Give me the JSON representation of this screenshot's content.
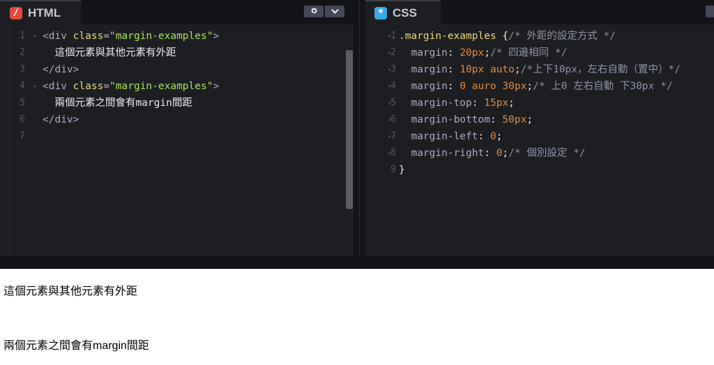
{
  "html_panel": {
    "title": "HTML",
    "badge": "/",
    "settings_icon": "gear-icon",
    "collapse_icon": "chevron-down-icon",
    "lines": [
      {
        "n": "1",
        "parts": [
          [
            "tag",
            "<div "
          ],
          [
            "attr",
            "class"
          ],
          [
            "tag",
            "="
          ],
          [
            "str",
            "\"margin-examples\""
          ],
          [
            "tag",
            ">"
          ]
        ]
      },
      {
        "n": "2",
        "parts": [
          [
            "plain",
            "  這個元素與其他元素有外距"
          ]
        ]
      },
      {
        "n": "3",
        "parts": [
          [
            "tag",
            "</div>"
          ]
        ]
      },
      {
        "n": "4",
        "parts": [
          [
            "tag",
            "<div "
          ],
          [
            "attr",
            "class"
          ],
          [
            "tag",
            "="
          ],
          [
            "str",
            "\"margin-examples\""
          ],
          [
            "tag",
            ">"
          ]
        ]
      },
      {
        "n": "5",
        "parts": [
          [
            "plain",
            "  兩個元素之間會有margin間距"
          ]
        ]
      },
      {
        "n": "6",
        "parts": [
          [
            "tag",
            "</div>"
          ]
        ]
      },
      {
        "n": "7",
        "parts": []
      }
    ]
  },
  "css_panel": {
    "title": "CSS",
    "badge": "*",
    "lines": [
      {
        "n": "1",
        "parts": [
          [
            "sel",
            ".margin-examples "
          ],
          [
            "punct",
            "{"
          ],
          [
            "cmt",
            "/* 外距的設定方式 */"
          ]
        ]
      },
      {
        "n": "2",
        "parts": [
          [
            "prop",
            "  margin"
          ],
          [
            "punct",
            ": "
          ],
          [
            "num",
            "20px"
          ],
          [
            "punct",
            ";"
          ],
          [
            "cmt",
            "/* 四邊相同 */"
          ]
        ]
      },
      {
        "n": "3",
        "parts": [
          [
            "prop",
            "  margin"
          ],
          [
            "punct",
            ": "
          ],
          [
            "num",
            "10px"
          ],
          [
            "punct",
            " "
          ],
          [
            "kw",
            "auto"
          ],
          [
            "punct",
            ";"
          ],
          [
            "cmt",
            "/*上下10px，左右自動（置中）*/"
          ]
        ]
      },
      {
        "n": "4",
        "parts": [
          [
            "prop",
            "  margin"
          ],
          [
            "punct",
            ": "
          ],
          [
            "num",
            "0"
          ],
          [
            "punct",
            " "
          ],
          [
            "kw",
            "auro"
          ],
          [
            "punct",
            " "
          ],
          [
            "num",
            "30px"
          ],
          [
            "punct",
            ";"
          ],
          [
            "cmt",
            "/* 上0 左右自動 下30px */"
          ]
        ]
      },
      {
        "n": "5",
        "parts": [
          [
            "prop",
            "  margin-top"
          ],
          [
            "punct",
            ": "
          ],
          [
            "num",
            "15px"
          ],
          [
            "punct",
            ";"
          ]
        ]
      },
      {
        "n": "6",
        "parts": [
          [
            "prop",
            "  margin-bottom"
          ],
          [
            "punct",
            ": "
          ],
          [
            "num",
            "50px"
          ],
          [
            "punct",
            ";"
          ]
        ]
      },
      {
        "n": "7",
        "parts": [
          [
            "prop",
            "  margin-left"
          ],
          [
            "punct",
            ": "
          ],
          [
            "num",
            "0"
          ],
          [
            "punct",
            ";"
          ]
        ]
      },
      {
        "n": "8",
        "parts": [
          [
            "prop",
            "  margin-right"
          ],
          [
            "punct",
            ": "
          ],
          [
            "num",
            "0"
          ],
          [
            "punct",
            ";"
          ],
          [
            "cmt",
            "/* 個別設定 */"
          ]
        ]
      },
      {
        "n": "9",
        "parts": [
          [
            "punct",
            "}"
          ]
        ]
      }
    ]
  },
  "preview": {
    "line1": "這個元素與其他元素有外距",
    "line2": "兩個元素之間會有margin間距"
  }
}
